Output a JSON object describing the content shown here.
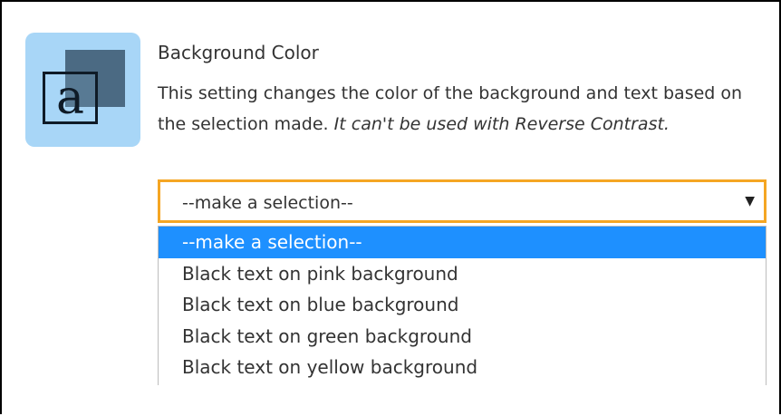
{
  "setting": {
    "title": "Background Color",
    "description_main": "This setting changes the color of the background and text based on the selection made.",
    "description_note": "It can't be used with Reverse Contrast.",
    "icon": {
      "name": "letter-a-icon",
      "letter": "a"
    }
  },
  "select": {
    "value": "--make a selection--",
    "arrow": "▼",
    "options": [
      "--make a selection--",
      "Black text on pink background",
      "Black text on blue background",
      "Black text on green background",
      "Black text on yellow background"
    ]
  },
  "colors": {
    "tile": "#a8d6f7",
    "focus_border": "#f5a623",
    "selected_option": "#1e90ff"
  }
}
